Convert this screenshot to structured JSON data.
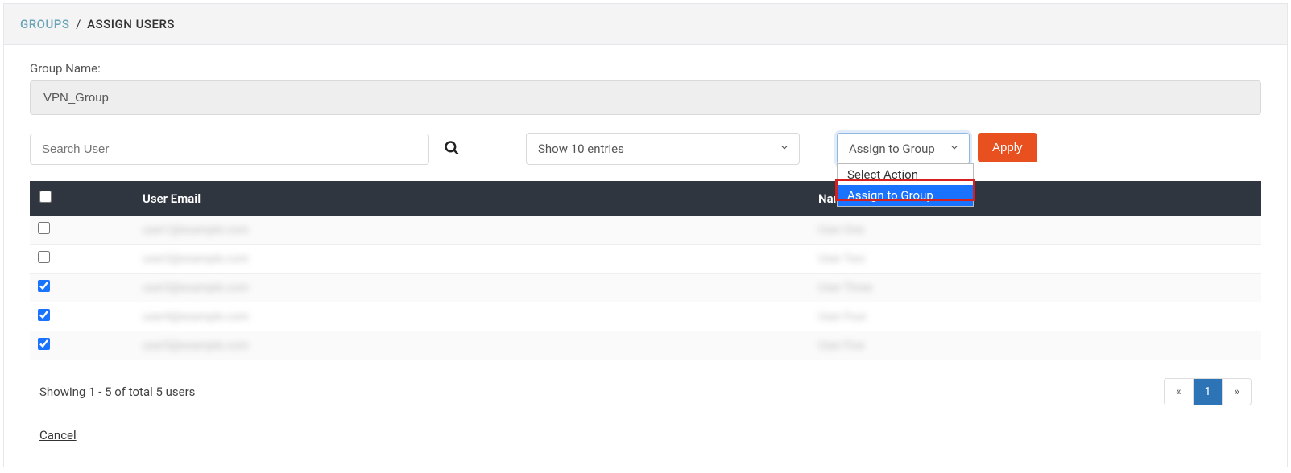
{
  "breadcrumb": {
    "parent": "GROUPS",
    "current": "ASSIGN USERS"
  },
  "form": {
    "group_name_label": "Group Name:",
    "group_name_value": "VPN_Group",
    "search_placeholder": "Search User",
    "entries_label": "Show 10 entries",
    "action_selected": "Assign to Group",
    "action_options": {
      "placeholder": "Select Action",
      "assign": "Assign to Group"
    },
    "apply_label": "Apply"
  },
  "table": {
    "headers": {
      "email": "User Email",
      "name": "Name"
    },
    "rows": [
      {
        "checked": false,
        "email": "user1@example.com",
        "name": "User One"
      },
      {
        "checked": false,
        "email": "user2@example.com",
        "name": "User Two"
      },
      {
        "checked": true,
        "email": "user3@example.com",
        "name": "User Three"
      },
      {
        "checked": true,
        "email": "user4@example.com",
        "name": "User Four"
      },
      {
        "checked": true,
        "email": "user5@example.com",
        "name": "User Five"
      }
    ]
  },
  "footer": {
    "showing": "Showing 1 - 5 of total 5 users",
    "pager": {
      "prev": "«",
      "page": "1",
      "next": "»"
    },
    "cancel": "Cancel"
  }
}
